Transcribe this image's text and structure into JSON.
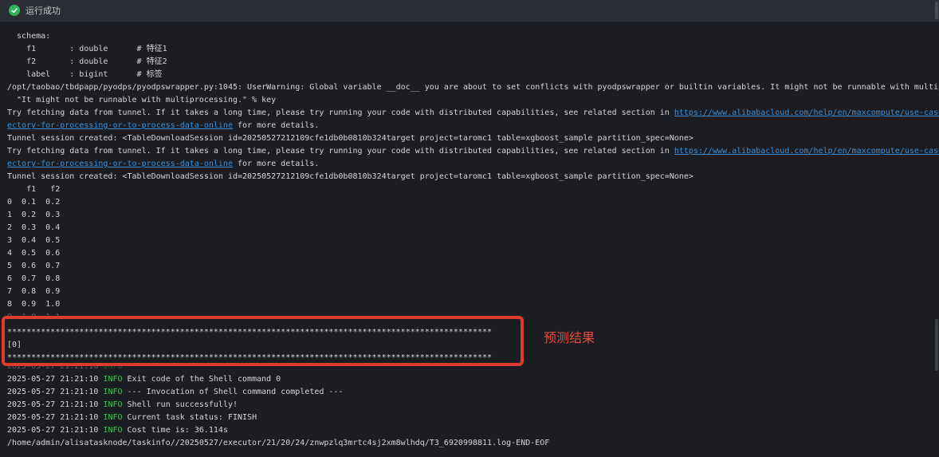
{
  "status": {
    "text": "运行成功",
    "icon": "check-circle-icon",
    "color": "#2fb45a"
  },
  "console": {
    "lines": [
      {
        "text": "  schema:"
      },
      {
        "text": "    f1       : double      # 特征1"
      },
      {
        "text": "    f2       : double      # 特征2"
      },
      {
        "text": "    label    : bigint      # 标签"
      },
      {
        "text": "/opt/taobao/tbdpapp/pyodps/pyodpswrapper.py:1045: UserWarning: Global variable __doc__ you are about to set conflicts with pyodpswrapper or builtin variables. It might not be runnable with multip"
      },
      {
        "text": "  \"It might not be runnable with multiprocessing.\" % key"
      },
      {
        "text": "Try fetching data from tunnel. If it takes a long time, please try running your code with distributed capabilities, see related section in ",
        "link": "https://www.alibabacloud.com/help/en/maxcompute/use-case"
      },
      {
        "text": "",
        "link": "ectory-for-processing-or-to-process-data-online",
        "after": " for more details."
      },
      {
        "text": "Tunnel session created: <TableDownloadSession id=20250527212109cfe1db0b0810b324target project=taromc1 table=xgboost_sample partition_spec=None>"
      },
      {
        "text": "Try fetching data from tunnel. If it takes a long time, please try running your code with distributed capabilities, see related section in ",
        "link": "https://www.alibabacloud.com/help/en/maxcompute/use-case"
      },
      {
        "text": "",
        "link": "ectory-for-processing-or-to-process-data-online",
        "after": " for more details."
      },
      {
        "text": "Tunnel session created: <TableDownloadSession id=20250527212109cfe1db0b0810b324target project=taromc1 table=xgboost_sample partition_spec=None>"
      },
      {
        "text": "    f1   f2"
      },
      {
        "text": "0  0.1  0.2"
      },
      {
        "text": "1  0.2  0.3"
      },
      {
        "text": "2  0.3  0.4"
      },
      {
        "text": "3  0.4  0.5"
      },
      {
        "text": "4  0.5  0.6"
      },
      {
        "text": "5  0.6  0.7"
      },
      {
        "text": "6  0.7  0.8"
      },
      {
        "text": "7  0.8  0.9"
      },
      {
        "text": "8  0.9  1.0"
      },
      {
        "text": "9  1.0  1.1"
      },
      {
        "text": "*****************************************************************************************************"
      },
      {
        "text": "[0]"
      },
      {
        "text": "*****************************************************************************************************"
      },
      {
        "text": "2025-05-27 21:21:10 ",
        "info": "INFO",
        "after": ""
      },
      {
        "text": "2025-05-27 21:21:10 ",
        "info": "INFO",
        "after": " Exit code of the Shell command 0"
      },
      {
        "text": "2025-05-27 21:21:10 ",
        "info": "INFO",
        "after": " --- Invocation of Shell command completed ---"
      },
      {
        "text": "2025-05-27 21:21:10 ",
        "info": "INFO",
        "after": " Shell run successfully!"
      },
      {
        "text": "2025-05-27 21:21:10 ",
        "info": "INFO",
        "after": " Current task status: FINISH"
      },
      {
        "text": "2025-05-27 21:21:10 ",
        "info": "INFO",
        "after": " Cost time is: 36.114s"
      },
      {
        "text": "/home/admin/alisatasknode/taskinfo//20250527/executor/21/20/24/znwpzlq3mrtc4sj2xm8wlhdq/T3_6920998811.log-END-EOF"
      }
    ]
  },
  "annotation": {
    "label": "预测结果",
    "color": "#e03a2e"
  }
}
